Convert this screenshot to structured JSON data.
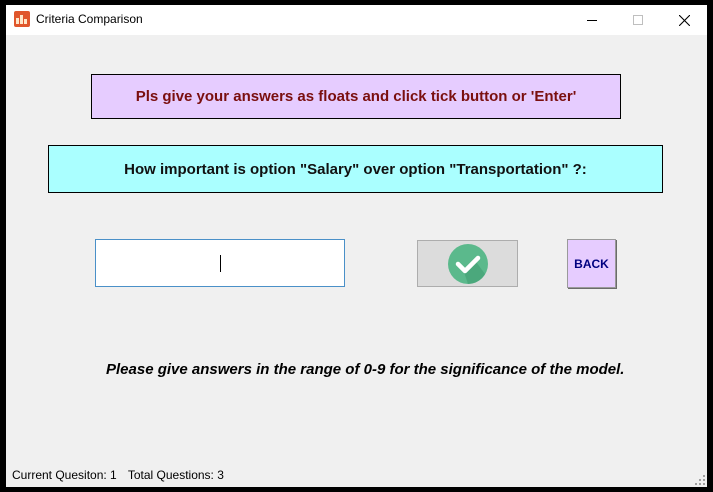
{
  "window": {
    "title": "Criteria Comparison",
    "app_icon": "chart-app-icon",
    "controls": {
      "minimize_icon": "minimize-icon",
      "maximize_icon": "maximize-icon",
      "close_icon": "close-icon"
    }
  },
  "main": {
    "instruction": "Pls give your answers as floats and click tick button or 'Enter'",
    "question": "How important is option \"Salary\" over option \"Transportation\" ?:",
    "answer_input": {
      "value": "",
      "placeholder": ""
    },
    "tick_button_icon": "check-circle-icon",
    "back_label": "BACK",
    "hint": "Please give answers in the range of 0-9 for the significance of the model."
  },
  "status": {
    "current_question": "Current Quesiton: 1",
    "total_questions": "Total Questions: 3"
  },
  "colors": {
    "instruction_bg": "#e6ccff",
    "instruction_text": "#7a0f0f",
    "question_bg": "#aaffff",
    "tick_circle": "#5bb98c",
    "back_bg": "#e6ccff",
    "back_text": "#000080",
    "input_border": "#4a90c8"
  }
}
